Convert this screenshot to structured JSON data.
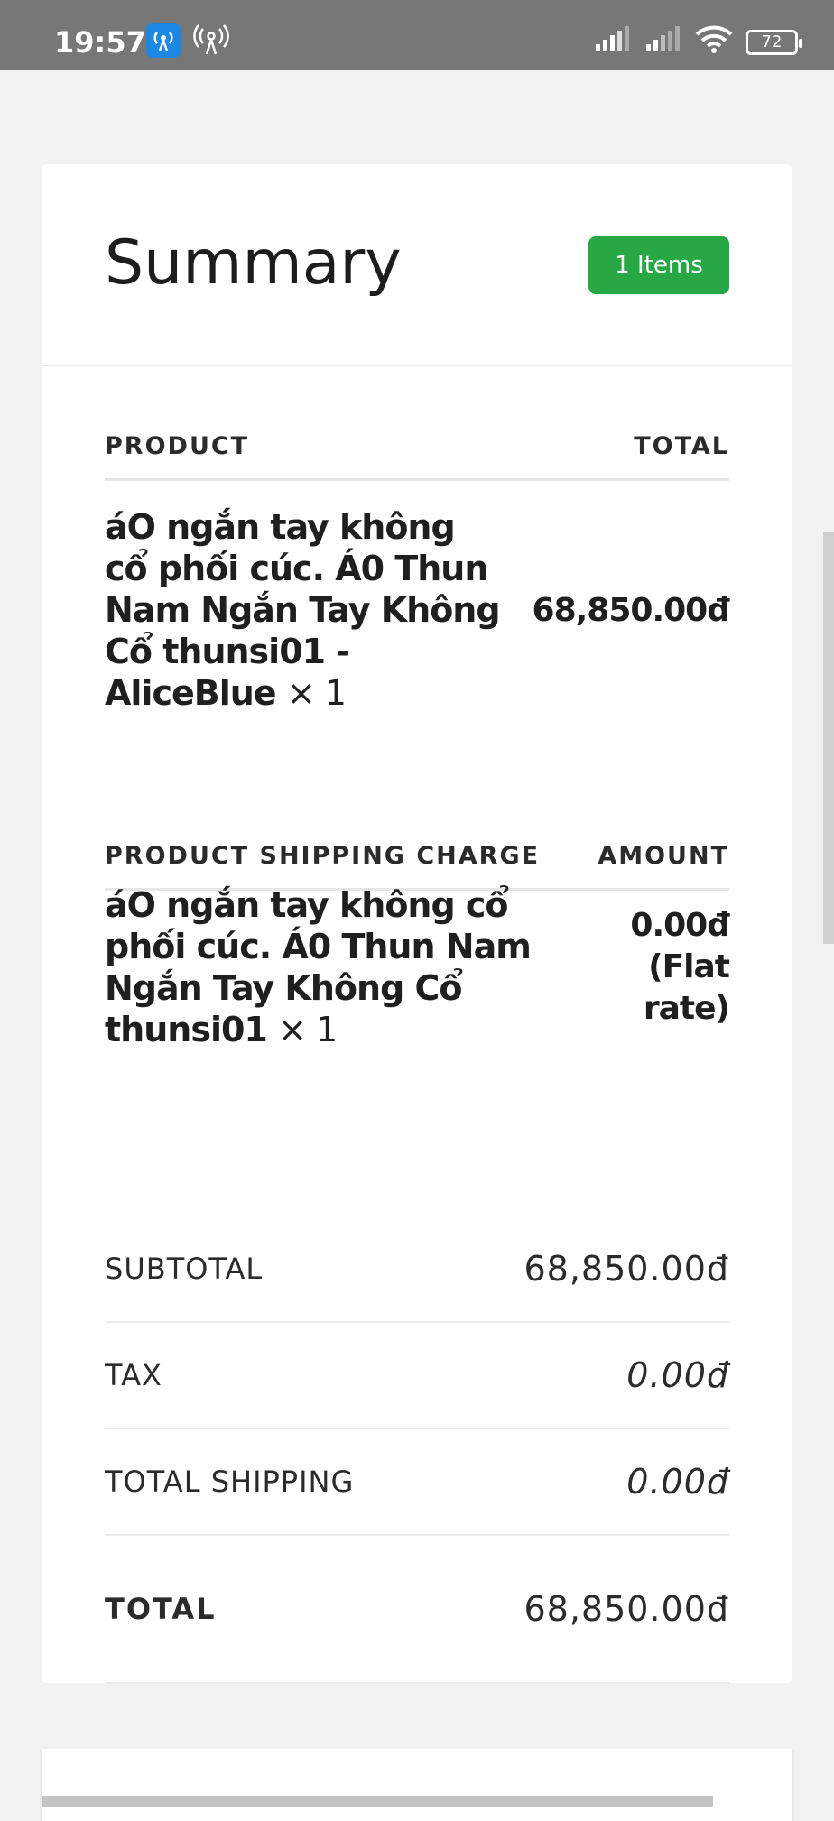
{
  "status_bar": {
    "time": "19:57",
    "battery": "72",
    "icons": [
      "hotspot-app-icon",
      "hotspot-icon",
      "signal-icon",
      "signal-icon",
      "wifi-icon",
      "battery-icon"
    ]
  },
  "summary": {
    "title": "Summary",
    "items_badge": "1 Items",
    "badge_color": "#28a745",
    "product_header": {
      "left": "PRODUCT",
      "right": "TOTAL"
    },
    "product": {
      "name": "áO ngắn tay không cổ phối cúc. Á0 Thun Nam Ngắn Tay Không Cổ thunsi01 - AliceBlue",
      "qty": "× 1",
      "total": "68,850.00đ"
    },
    "shipping_header": {
      "left": "PRODUCT SHIPPING CHARGE",
      "right": "AMOUNT"
    },
    "shipping": {
      "name": "áO ngắn tay không cổ phối cúc. Á0 Thun Nam Ngắn Tay Không Cổ thunsi01",
      "qty": "× 1",
      "amount_line1": "0.00đ",
      "amount_line2": "(Flat",
      "amount_line3": "rate)"
    },
    "totals": {
      "subtotal_label": "SUBTOTAL",
      "subtotal_value": "68,850.00đ",
      "tax_label": "TAX",
      "tax_value": "0.00đ",
      "shipping_label": "TOTAL SHIPPING",
      "shipping_value": "0.00đ",
      "total_label": "TOTAL",
      "total_value": "68,850.00đ"
    }
  }
}
